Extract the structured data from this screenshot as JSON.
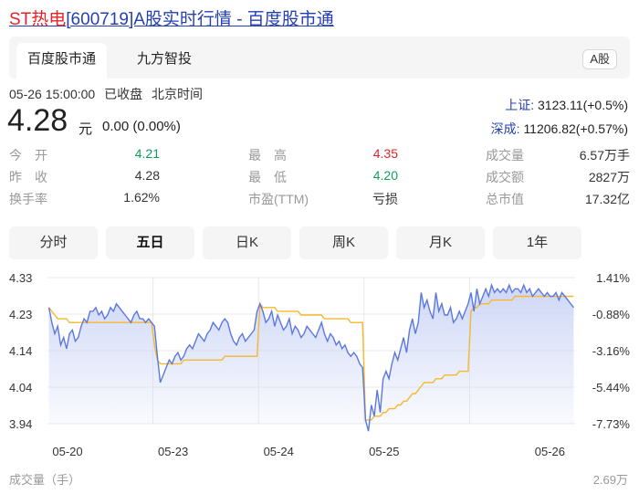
{
  "header": {
    "name": "ST热电",
    "title_rest": "[600719]A股实时行情 - 百度股市通"
  },
  "tabs": [
    {
      "label": "百度股市通",
      "active": true
    },
    {
      "label": "九方智投",
      "active": false
    }
  ],
  "market_badge": "A股",
  "status": {
    "datetime": "05-26 15:00:00",
    "state": "已收盘",
    "timezone": "北京时间"
  },
  "quote": {
    "price": "4.28",
    "unit": "元",
    "change": "0.00 (0.00%)"
  },
  "indices": [
    {
      "name": "上证:",
      "value": "3123.11(+0.5%)"
    },
    {
      "name": "深成:",
      "value": "11206.82(+0.57%)"
    }
  ],
  "stats": [
    [
      {
        "label": "今　开",
        "value": "4.21",
        "color": "green"
      },
      {
        "label": "最　高",
        "value": "4.35",
        "color": "red"
      },
      {
        "label": "成交量",
        "value": "6.57万手",
        "color": "neutral"
      }
    ],
    [
      {
        "label": "昨　收",
        "value": "4.28",
        "color": "neutral"
      },
      {
        "label": "最　低",
        "value": "4.20",
        "color": "green"
      },
      {
        "label": "成交额",
        "value": "2827万",
        "color": "neutral"
      }
    ],
    [
      {
        "label": "换手率",
        "value": "1.62%",
        "color": "neutral"
      },
      {
        "label": "市盈(TTM)",
        "value": "亏损",
        "color": "neutral"
      },
      {
        "label": "总市值",
        "value": "17.32亿",
        "color": "neutral"
      }
    ]
  ],
  "periods": [
    {
      "label": "分时",
      "active": false
    },
    {
      "label": "五日",
      "active": true
    },
    {
      "label": "日K",
      "active": false
    },
    {
      "label": "周K",
      "active": false
    },
    {
      "label": "月K",
      "active": false
    },
    {
      "label": "1年",
      "active": false
    }
  ],
  "colors": {
    "price_line": "#5b78e0",
    "avg_line": "#f5b82e",
    "fill_top": "#c9d3f6",
    "up": "#e0242a",
    "down": "#11a05c"
  },
  "chart_data": {
    "type": "line",
    "y_left_ticks": [
      "4.33",
      "4.23",
      "4.14",
      "4.04",
      "3.94"
    ],
    "y_right_ticks": [
      "1.41%",
      "-0.88%",
      "-3.16%",
      "-5.44%",
      "-7.73%"
    ],
    "ylim": [
      3.94,
      4.33
    ],
    "x_labels": [
      "05-20",
      "05-23",
      "05-24",
      "05-25",
      "05-26"
    ],
    "days": 5,
    "series": [
      {
        "values": [
          [
            4.25,
            4.21,
            4.18,
            4.2,
            4.15,
            4.17,
            4.14,
            4.18,
            4.19,
            4.16,
            4.17,
            4.2,
            4.22,
            4.21,
            4.24,
            4.24,
            4.25,
            4.23,
            4.24,
            4.22,
            4.23,
            4.25,
            4.24,
            4.26,
            4.25,
            4.24,
            4.23,
            4.22,
            4.21,
            4.23,
            4.24,
            4.22,
            4.22,
            4.21,
            4.22,
            4.21
          ],
          [
            4.2,
            4.12,
            4.05,
            4.07,
            4.09,
            4.11,
            4.1,
            4.12,
            4.13,
            4.11,
            4.12,
            4.14,
            4.15,
            4.14,
            4.16,
            4.18,
            4.17,
            4.16,
            4.18,
            4.19,
            4.21,
            4.2,
            4.19,
            4.21,
            4.22,
            4.21,
            4.18,
            4.16,
            4.15,
            4.17,
            4.18,
            4.16,
            4.17,
            4.18,
            4.19,
            4.24
          ],
          [
            4.26,
            4.24,
            4.21,
            4.22,
            4.24,
            4.2,
            4.23,
            4.21,
            4.19,
            4.2,
            4.22,
            4.18,
            4.2,
            4.19,
            4.17,
            4.18,
            4.2,
            4.19,
            4.18,
            4.17,
            4.19,
            4.21,
            4.18,
            4.16,
            4.18,
            4.17,
            4.15,
            4.16,
            4.14,
            4.15,
            4.13,
            4.12,
            4.13,
            4.12,
            4.1,
            4.09
          ],
          [
            3.95,
            3.92,
            3.99,
            3.96,
            4.03,
            3.97,
            4.06,
            4.08,
            4.06,
            4.1,
            4.13,
            4.11,
            4.14,
            4.17,
            4.13,
            4.19,
            4.22,
            4.18,
            4.21,
            4.29,
            4.25,
            4.27,
            4.24,
            4.22,
            4.29,
            4.24,
            4.26,
            4.23,
            4.23,
            4.25,
            4.21,
            4.22,
            4.24,
            4.22,
            4.24,
            4.26
          ],
          [
            4.29,
            4.24,
            4.3,
            4.26,
            4.28,
            4.3,
            4.28,
            4.31,
            4.29,
            4.3,
            4.29,
            4.3,
            4.29,
            4.31,
            4.29,
            4.3,
            4.3,
            4.29,
            4.31,
            4.29,
            4.3,
            4.28,
            4.29,
            4.3,
            4.29,
            4.28,
            4.29,
            4.28,
            4.28,
            4.29,
            4.27,
            4.29,
            4.28,
            4.27,
            4.26,
            4.25
          ]
        ]
      },
      {
        "values": [
          [
            4.25,
            4.24,
            4.23,
            4.22,
            4.22,
            4.22,
            4.22,
            4.21,
            4.21,
            4.21,
            4.21,
            4.21,
            4.21,
            4.21,
            4.21,
            4.21,
            4.21,
            4.21,
            4.21,
            4.21,
            4.21,
            4.21,
            4.21,
            4.21,
            4.21,
            4.21,
            4.21,
            4.21,
            4.21,
            4.21,
            4.21,
            4.21,
            4.21,
            4.21,
            4.21,
            4.21
          ],
          [
            4.15,
            4.11,
            4.1,
            4.1,
            4.1,
            4.1,
            4.1,
            4.1,
            4.1,
            4.1,
            4.11,
            4.11,
            4.11,
            4.11,
            4.11,
            4.11,
            4.11,
            4.11,
            4.11,
            4.11,
            4.11,
            4.11,
            4.11,
            4.11,
            4.12,
            4.12,
            4.12,
            4.12,
            4.12,
            4.12,
            4.12,
            4.12,
            4.12,
            4.12,
            4.12,
            4.12
          ],
          [
            4.26,
            4.25,
            4.25,
            4.25,
            4.25,
            4.25,
            4.24,
            4.24,
            4.24,
            4.24,
            4.24,
            4.24,
            4.24,
            4.24,
            4.23,
            4.23,
            4.23,
            4.23,
            4.23,
            4.23,
            4.23,
            4.23,
            4.22,
            4.22,
            4.22,
            4.22,
            4.22,
            4.22,
            4.22,
            4.22,
            4.22,
            4.21,
            4.21,
            4.21,
            4.21,
            4.21
          ],
          [
            3.95,
            3.95,
            3.95,
            3.96,
            3.96,
            3.96,
            3.97,
            3.97,
            3.98,
            3.98,
            3.98,
            3.99,
            3.99,
            4.0,
            4.0,
            4.01,
            4.02,
            4.02,
            4.03,
            4.04,
            4.05,
            4.05,
            4.05,
            4.05,
            4.06,
            4.06,
            4.06,
            4.07,
            4.07,
            4.07,
            4.07,
            4.07,
            4.08,
            4.08,
            4.08,
            4.08
          ],
          [
            4.24,
            4.25,
            4.25,
            4.26,
            4.26,
            4.26,
            4.26,
            4.27,
            4.27,
            4.27,
            4.27,
            4.27,
            4.27,
            4.27,
            4.27,
            4.28,
            4.28,
            4.28,
            4.28,
            4.28,
            4.28,
            4.28,
            4.28,
            4.28,
            4.28,
            4.28,
            4.28,
            4.28,
            4.28,
            4.28,
            4.28,
            4.28,
            4.28,
            4.28,
            4.28,
            4.28
          ]
        ]
      }
    ]
  },
  "volume": {
    "label": "成交量（手）",
    "max": "2.69万"
  }
}
